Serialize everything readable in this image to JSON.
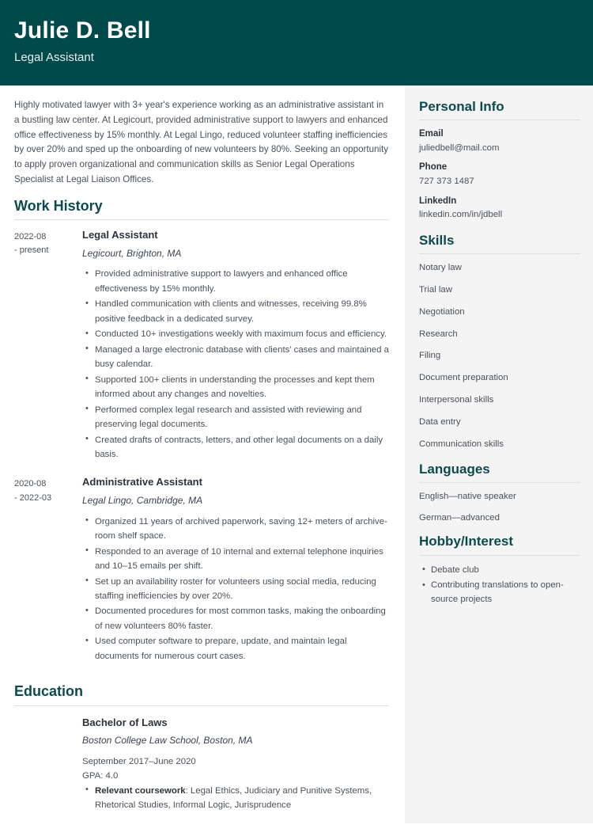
{
  "header": {
    "name": "Julie D. Bell",
    "job_title": "Legal Assistant",
    "background_color": "#014a4c"
  },
  "theme": {
    "accent_color": "#0d4a4e",
    "sidebar_background": "#f4f4f4",
    "text_color": "#4a5159"
  },
  "main": {
    "summary": "Highly motivated lawyer with 3+ year's experience working as an administrative assistant in a bustling law center. At Legicourt, provided administrative support to lawyers and enhanced office effectiveness by 15% monthly. At Legal Lingo, reduced volunteer staffing inefficiencies by over 20% and sped up the onboarding of new volunteers by 80%. Seeking an opportunity to apply proven organizational and communication skills as Senior Legal Operations Specialist at Legal Liaison Offices.",
    "work_history": {
      "title": "Work History",
      "entries": [
        {
          "date_start": "2022-08",
          "date_end": "- present",
          "role": "Legal Assistant",
          "organization": "Legicourt, Brighton, MA",
          "bullets": [
            "Provided administrative support to lawyers and enhanced office effectiveness by 15% monthly.",
            "Handled communication with clients and witnesses, receiving 99.8% positive feedback in a dedicated survey.",
            "Conducted 10+ investigations weekly with maximum focus and efficiency.",
            "Managed a large electronic database with clients' cases and maintained a busy calendar.",
            "Supported 100+ clients in understanding the processes and kept them informed about any changes and novelties.",
            "Performed complex legal research and assisted with reviewing and preserving legal documents.",
            "Created drafts of contracts, letters, and other legal documents on a daily basis."
          ]
        },
        {
          "date_start": "2020-08",
          "date_end": "- 2022-03",
          "role": "Administrative Assistant",
          "organization": "Legal Lingo, Cambridge, MA",
          "bullets": [
            "Organized 11 years of archived paperwork, saving 12+ meters of archive-room shelf space.",
            "Responded to an average of 10 internal and external telephone inquiries and 10–15 emails per shift.",
            "Set up an availability roster for volunteers using social media, reducing staffing inefficiencies by over 20%.",
            "Documented procedures for most common tasks, making the onboarding of new volunteers 80% faster.",
            "Used computer software to prepare, update, and maintain legal documents for numerous court cases."
          ]
        }
      ]
    },
    "education": {
      "title": "Education",
      "entries": [
        {
          "date_start": "",
          "date_end": "",
          "degree": "Bachelor of Laws",
          "school": "Boston College Law School, Boston, MA",
          "dates": "September 2017–June 2020",
          "gpa": "GPA: 4.0",
          "coursework_label": "Relevant coursework",
          "coursework_text": ": Legal Ethics, Judiciary and Punitive Systems, Rhetorical Studies, Informal Logic, Jurisprudence"
        }
      ]
    }
  },
  "sidebar": {
    "personal_info": {
      "title": "Personal Info",
      "items": [
        {
          "label": "Email",
          "value": "juliedbell@mail.com"
        },
        {
          "label": "Phone",
          "value": "727 373 1487"
        },
        {
          "label": "LinkedIn",
          "value": "linkedin.com/in/jdbell"
        }
      ]
    },
    "skills": {
      "title": "Skills",
      "items": [
        "Notary law",
        "Trial law",
        "Negotiation",
        "Research",
        "Filing",
        "Document preparation",
        "Interpersonal skills",
        "Data entry",
        "Communication skills"
      ]
    },
    "languages": {
      "title": "Languages",
      "items": [
        "English—native speaker",
        "German—advanced"
      ]
    },
    "hobbies": {
      "title": "Hobby/Interest",
      "items": [
        "Debate club",
        "Contributing translations to open-source projects"
      ]
    }
  }
}
